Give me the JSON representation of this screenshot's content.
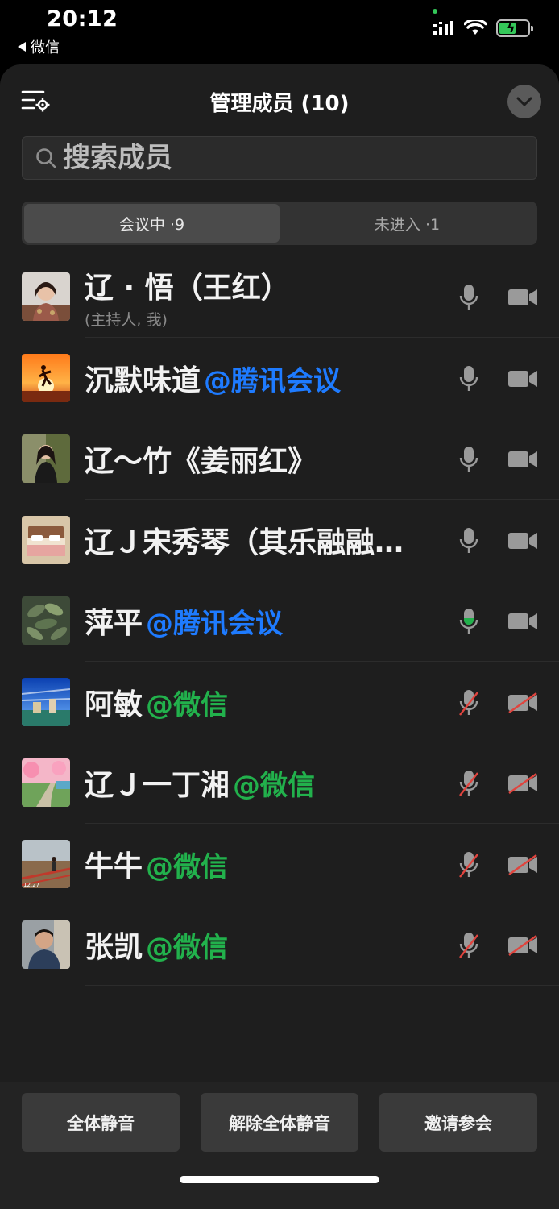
{
  "status_bar": {
    "time": "20:12",
    "back_app": "微信"
  },
  "header": {
    "title": "管理成员 (10)"
  },
  "search": {
    "placeholder": "搜索成员"
  },
  "tabs": [
    {
      "label": "会议中 ·9",
      "active": true
    },
    {
      "label": "未进入 ·1",
      "active": false
    }
  ],
  "members": [
    {
      "name": "辽 · 悟（王红）",
      "tag": "",
      "tag_color": "",
      "subtitle": "(主持人, 我)",
      "mic": "on",
      "mic_color": "#9a9a9a",
      "cam": "on",
      "avatar": "portrait-woman"
    },
    {
      "name": "沉默味道",
      "tag": "@腾讯会议",
      "tag_color": "blue",
      "subtitle": "",
      "mic": "on",
      "mic_color": "#9a9a9a",
      "cam": "on",
      "avatar": "sunset-runner"
    },
    {
      "name": "辽～竹《姜丽红》",
      "tag": "",
      "tag_color": "",
      "subtitle": "",
      "mic": "on",
      "mic_color": "#9a9a9a",
      "cam": "on",
      "avatar": "portrait-woman-2"
    },
    {
      "name": "辽Ｊ宋秀琴（其乐融融…",
      "tag": "",
      "tag_color": "",
      "subtitle": "",
      "mic": "on",
      "mic_color": "#9a9a9a",
      "cam": "on",
      "avatar": "bedroom"
    },
    {
      "name": "萍平",
      "tag": "@腾讯会议",
      "tag_color": "blue",
      "subtitle": "",
      "mic": "active",
      "mic_color": "#22b14c",
      "cam": "on",
      "avatar": "plant-leaves"
    },
    {
      "name": "阿敏",
      "tag": "@微信",
      "tag_color": "green",
      "subtitle": "",
      "mic": "muted",
      "mic_color": "#9a9a9a",
      "cam": "off",
      "avatar": "blue-sky-landscape"
    },
    {
      "name": "辽Ｊ一丁湘",
      "tag": "@微信",
      "tag_color": "green",
      "subtitle": "",
      "mic": "muted",
      "mic_color": "#9a9a9a",
      "cam": "off",
      "avatar": "pink-blossom-path"
    },
    {
      "name": "牛牛",
      "tag": "@微信",
      "tag_color": "green",
      "subtitle": "",
      "mic": "muted",
      "mic_color": "#9a9a9a",
      "cam": "off",
      "avatar": "boardwalk-person",
      "avatar_caption": "12.27"
    },
    {
      "name": "张凯",
      "tag": "@微信",
      "tag_color": "green",
      "subtitle": "",
      "mic": "muted",
      "mic_color": "#9a9a9a",
      "cam": "off",
      "avatar": "portrait-man"
    }
  ],
  "footer": {
    "mute_all": "全体静音",
    "unmute_all": "解除全体静音",
    "invite": "邀请参会"
  },
  "colors": {
    "panel_bg": "#1e1e1e",
    "blue_tag": "#1e7bff",
    "green_tag": "#22b14c",
    "muted_slash": "#e0443e"
  }
}
